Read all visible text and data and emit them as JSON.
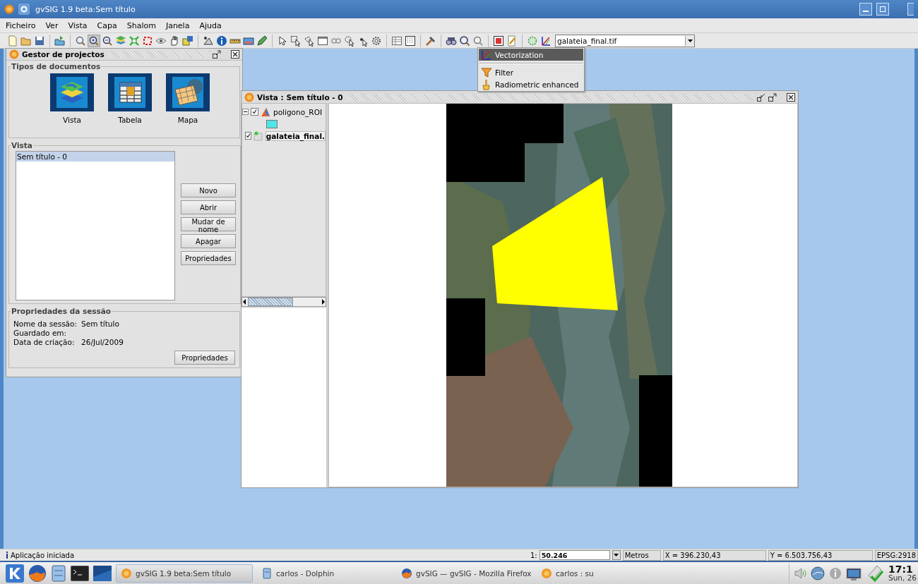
{
  "window": {
    "title": "gvSIG 1.9 beta:Sem título"
  },
  "menu": [
    "Ficheiro",
    "Ver",
    "Vista",
    "Capa",
    "Shalom",
    "Janela",
    "Ajuda"
  ],
  "toolbar": {
    "layer_combo": "galateia_final.tif"
  },
  "popup_menu": {
    "items": [
      {
        "label": "Vectorization",
        "selected": true,
        "kind": "vector"
      },
      {
        "label": "Filter",
        "selected": false,
        "kind": "filter"
      },
      {
        "label": "Radiometric enhanced",
        "selected": false,
        "kind": "brush"
      }
    ]
  },
  "project_manager": {
    "title": "Gestor de projectos",
    "documents_group": "Tipos de documentos",
    "document_types": [
      {
        "label": "Vista",
        "kind": "view"
      },
      {
        "label": "Tabela",
        "kind": "table"
      },
      {
        "label": "Mapa",
        "kind": "map"
      }
    ],
    "views_group": "Vista",
    "views": [
      {
        "label": "Sem título - 0",
        "selected": true
      }
    ],
    "buttons": [
      "Novo",
      "Abrir",
      "Mudar de nome",
      "Apagar",
      "Propriedades"
    ],
    "session_group": "Propriedades da sessão",
    "session_fields": [
      {
        "label": "Nome da sessão:",
        "value": "Sem título"
      },
      {
        "label": "Guardado em:"
      },
      {
        "label": "Data de criação:",
        "value": "26/Jul/2009"
      }
    ],
    "session_button": "Propriedades"
  },
  "view_window": {
    "title": "Vista : Sem título - 0",
    "layers": [
      {
        "name": "poligono_ROI",
        "checked": true,
        "expanded": true,
        "active": false,
        "kind": "vector",
        "legend": [
          {
            "color": "#4ee6e6"
          }
        ]
      },
      {
        "name": "galateia_final.",
        "checked": true,
        "active": true,
        "kind": "raster"
      }
    ]
  },
  "status_bar": {
    "message": "Aplicação iniciada",
    "scale_prefix": "1:",
    "scale": "50.246",
    "units": "Metros",
    "x": "X = 396.230,43",
    "y": "Y = 6.503.756,43",
    "crs": "EPSG:2918"
  },
  "taskbar": {
    "tasks": [
      {
        "label": "gvSIG 1.9 beta:Sem título",
        "selected": true,
        "kind": "gvsig"
      },
      {
        "label": "carlos - Dolphin",
        "selected": false,
        "kind": "files"
      },
      {
        "label": "gvSIG — gvSIG - Mozilla Firefox",
        "selected": false,
        "kind": "browser"
      },
      {
        "label": "carlos : su",
        "selected": false,
        "kind": "gvsig"
      }
    ],
    "clock_time": "17:1",
    "clock_date": "Sun, 26"
  }
}
